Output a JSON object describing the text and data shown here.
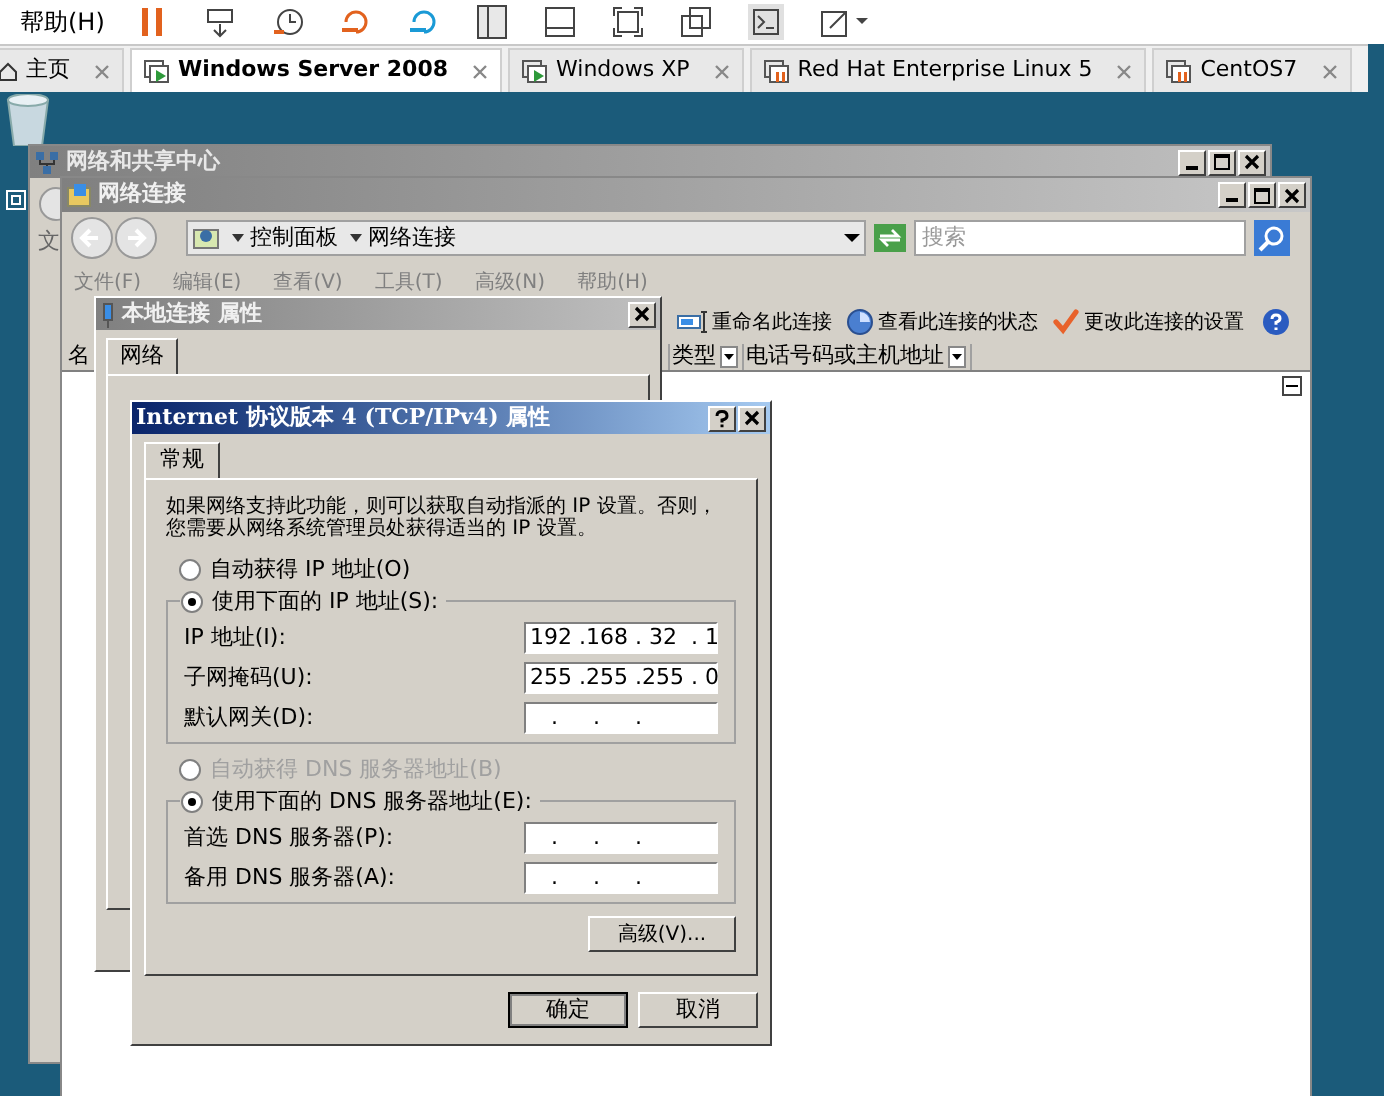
{
  "host_menu": {
    "help": "帮助(H)"
  },
  "vm_tabs": [
    {
      "label": "主页",
      "selected": false,
      "kind": "home"
    },
    {
      "label": "Windows Server 2008",
      "selected": true,
      "kind": "running"
    },
    {
      "label": "Windows XP",
      "selected": false,
      "kind": "running"
    },
    {
      "label": "Red Hat Enterprise Linux 5",
      "selected": false,
      "kind": "stopped"
    },
    {
      "label": "CentOS7",
      "selected": false,
      "kind": "stopped"
    }
  ],
  "sharing_center": {
    "title": "网络和共享中心",
    "menu_fragment": "文"
  },
  "connections": {
    "title": "网络连接",
    "breadcrumb": [
      "控制面板",
      "网络连接"
    ],
    "search_placeholder": "搜索",
    "menu": [
      "文件(F)",
      "编辑(E)",
      "查看(V)",
      "工具(T)",
      "高级(N)",
      "帮助(H)"
    ],
    "tasks": [
      {
        "label": "重命名此连接",
        "kind": "rename"
      },
      {
        "label": "查看此连接的状态",
        "kind": "status"
      },
      {
        "label": "更改此连接的设置",
        "kind": "settings"
      }
    ],
    "columns": [
      "名",
      "类型",
      "电话号码或主机地址"
    ]
  },
  "local_props": {
    "title": "本地连接 属性",
    "tab": "网络"
  },
  "ipv4": {
    "title": "Internet 协议版本 4 (TCP/IPv4) 属性",
    "tab": "常规",
    "description": [
      "如果网络支持此功能，则可以获取自动指派的 IP 设置。否则，",
      "您需要从网络系统管理员处获得适当的 IP 设置。"
    ],
    "ip_options": [
      {
        "label": "自动获得 IP 地址(O)",
        "selected": false,
        "disabled": false
      },
      {
        "label": "使用下面的 IP 地址(S):",
        "selected": true,
        "disabled": false
      }
    ],
    "ip_fields": [
      {
        "label": "IP 地址(I):",
        "value": "192 .168 . 32  . 1"
      },
      {
        "label": "子网掩码(U):",
        "value": "255 .255 .255 . 0"
      },
      {
        "label": "默认网关(D):",
        "value": "   .     .     ."
      }
    ],
    "dns_options": [
      {
        "label": "自动获得 DNS 服务器地址(B)",
        "selected": false,
        "disabled": true
      },
      {
        "label": "使用下面的 DNS 服务器地址(E):",
        "selected": true,
        "disabled": false
      }
    ],
    "dns_fields": [
      {
        "label": "首选 DNS 服务器(P):",
        "value": "   .     .     ."
      },
      {
        "label": "备用 DNS 服务器(A):",
        "value": "   .     .     ."
      }
    ],
    "advanced": "高级(V)...",
    "buttons": [
      {
        "label": "确定",
        "kind": "default"
      },
      {
        "label": "取消",
        "kind": "normal"
      }
    ]
  }
}
